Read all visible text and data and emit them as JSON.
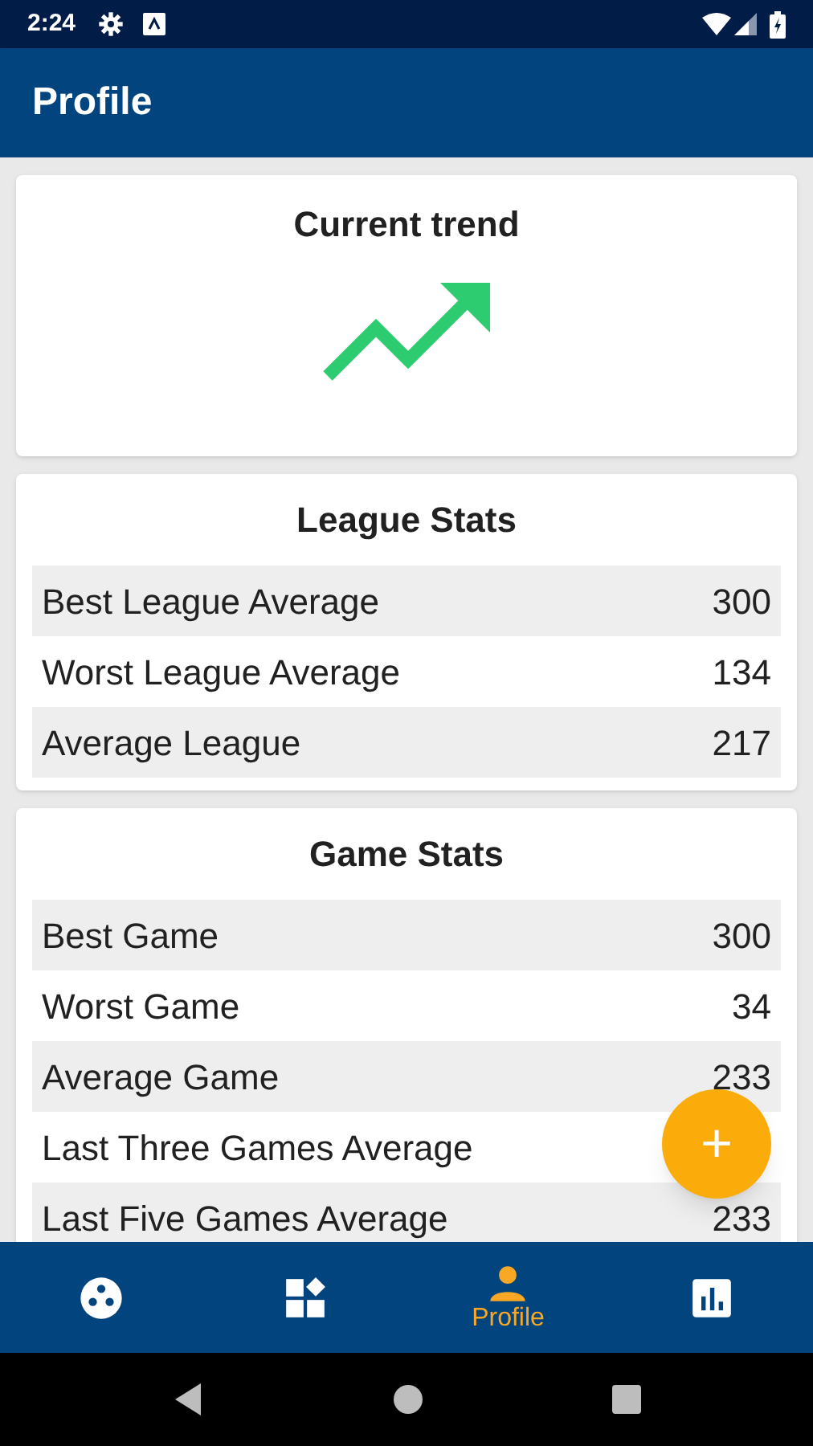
{
  "status_bar": {
    "time": "2:24"
  },
  "app_bar": {
    "title": "Profile"
  },
  "trend_card": {
    "title": "Current trend",
    "rising": true
  },
  "league_stats": {
    "title": "League Stats",
    "rows": [
      {
        "label": "Best League Average",
        "value": "300"
      },
      {
        "label": "Worst League Average",
        "value": "134"
      },
      {
        "label": "Average League",
        "value": "217"
      }
    ]
  },
  "game_stats": {
    "title": "Game Stats",
    "rows": [
      {
        "label": "Best Game",
        "value": "300"
      },
      {
        "label": "Worst Game",
        "value": "34"
      },
      {
        "label": "Average Game",
        "value": "233"
      },
      {
        "label": "Last Three Games Average"
      },
      {
        "label": "Last Five Games Average",
        "value": "233"
      }
    ]
  },
  "fab": {
    "label": "+"
  },
  "bottom_nav": [
    {
      "kind": "ball",
      "selected": false
    },
    {
      "kind": "dashboard",
      "selected": false
    },
    {
      "kind": "person",
      "label": "Profile",
      "selected": true
    },
    {
      "kind": "chart",
      "selected": false
    }
  ]
}
